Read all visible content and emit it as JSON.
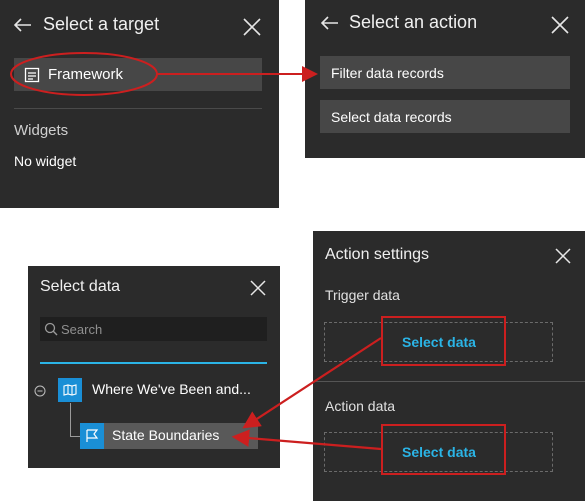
{
  "select_target": {
    "title": "Select a target",
    "framework_label": "Framework",
    "widgets_label": "Widgets",
    "no_widget_label": "No widget"
  },
  "select_action": {
    "title": "Select an action",
    "options": [
      "Filter data records",
      "Select data records"
    ]
  },
  "select_data": {
    "title": "Select data",
    "search_placeholder": "Search",
    "map_item_label": "Where We've Been and...",
    "layer_item_label": "State Boundaries"
  },
  "action_settings": {
    "title": "Action settings",
    "trigger_label": "Trigger data",
    "trigger_select_label": "Select data",
    "action_label": "Action data",
    "action_select_label": "Select data"
  },
  "colors": {
    "panel_bg": "#2b2b2b",
    "row_bg": "#474747",
    "accent_blue": "#2bb4e6",
    "annotation_red": "#cc1f1f"
  }
}
